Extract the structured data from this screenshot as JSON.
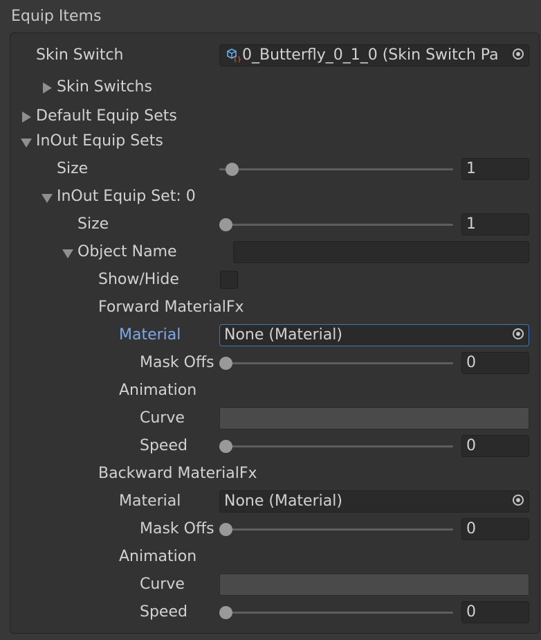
{
  "header": {
    "title": "Equip Items"
  },
  "skin_switch": {
    "label": "Skin Switch",
    "value": "0_Butterfly_0_1_0 (Skin Switch Pa",
    "icon": "prefab-script-icon"
  },
  "skin_switchs": {
    "label": "Skin Switchs"
  },
  "default_equip_sets": {
    "label": "Default Equip Sets"
  },
  "inout_equip_sets": {
    "label": "InOut Equip Sets",
    "size_label": "Size",
    "size_value": "1",
    "set0": {
      "label": "InOut Equip Set: 0",
      "size_label": "Size",
      "size_value": "1",
      "object_name": {
        "label": "Object Name",
        "value": "",
        "show_hide_label": "Show/Hide",
        "show_hide_checked": false,
        "forward": {
          "label": "Forward MaterialFx",
          "material_label": "Material",
          "material_value": "None (Material)",
          "mask_label": "Mask Offs",
          "mask_value": "0",
          "animation_label": "Animation",
          "curve_label": "Curve",
          "speed_label": "Speed",
          "speed_value": "0"
        },
        "backward": {
          "label": "Backward MaterialFx",
          "material_label": "Material",
          "material_value": "None (Material)",
          "mask_label": "Mask Offs",
          "mask_value": "0",
          "animation_label": "Animation",
          "curve_label": "Curve",
          "speed_label": "Speed",
          "speed_value": "0"
        }
      }
    }
  },
  "colors": {
    "background": "#383838",
    "panel": "#333333",
    "field": "#2a2a2a",
    "focus_border": "#3a79bb",
    "active_label": "#7fa8ea"
  }
}
